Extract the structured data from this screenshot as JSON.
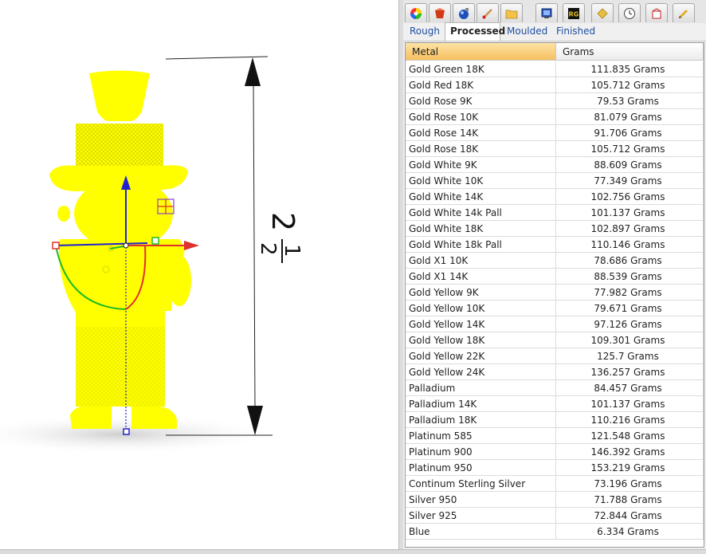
{
  "viewport": {
    "dimension": {
      "whole": "2",
      "numerator": "1",
      "denominator": "2"
    },
    "colors": {
      "model": "#ffff00",
      "x_axis": "#e03030",
      "y_axis": "#2222cc",
      "z_axis": "#22bb22"
    }
  },
  "panel": {
    "icon_tabs": [
      "color-wheel-icon",
      "rendering-icon",
      "material-sphere-icon",
      "brush-icon",
      "folder-icon",
      "display-icon",
      "rg-plugin-icon",
      "gem-icon",
      "clock-icon",
      "jewelry-box-icon",
      "pencil-icon"
    ],
    "rg_label": "RG",
    "sub_tabs": [
      "Rough",
      "Processed",
      "Moulded",
      "Finished"
    ],
    "active_sub_tab": "Processed",
    "table": {
      "headers": {
        "metal": "Metal",
        "grams": "Grams"
      },
      "rows": [
        {
          "metal": "Gold Green 18K",
          "grams": "111.835 Grams"
        },
        {
          "metal": "Gold Red 18K",
          "grams": "105.712 Grams"
        },
        {
          "metal": "Gold Rose 9K",
          "grams": "79.53 Grams"
        },
        {
          "metal": "Gold Rose 10K",
          "grams": "81.079 Grams"
        },
        {
          "metal": "Gold Rose 14K",
          "grams": "91.706 Grams"
        },
        {
          "metal": "Gold Rose 18K",
          "grams": "105.712 Grams"
        },
        {
          "metal": "Gold White 9K",
          "grams": "88.609 Grams"
        },
        {
          "metal": "Gold White 10K",
          "grams": "77.349 Grams"
        },
        {
          "metal": "Gold White 14K",
          "grams": "102.756 Grams"
        },
        {
          "metal": "Gold White 14k Pall",
          "grams": "101.137 Grams"
        },
        {
          "metal": "Gold White 18K",
          "grams": "102.897 Grams"
        },
        {
          "metal": "Gold White 18k Pall",
          "grams": "110.146 Grams"
        },
        {
          "metal": "Gold X1 10K",
          "grams": "78.686 Grams"
        },
        {
          "metal": "Gold X1 14K",
          "grams": "88.539 Grams"
        },
        {
          "metal": "Gold Yellow 9K",
          "grams": "77.982 Grams"
        },
        {
          "metal": "Gold Yellow 10K",
          "grams": "79.671 Grams"
        },
        {
          "metal": "Gold Yellow 14K",
          "grams": "97.126 Grams"
        },
        {
          "metal": "Gold Yellow 18K",
          "grams": "109.301 Grams"
        },
        {
          "metal": "Gold Yellow 22K",
          "grams": "125.7 Grams"
        },
        {
          "metal": "Gold Yellow 24K",
          "grams": "136.257 Grams"
        },
        {
          "metal": "Palladium",
          "grams": "84.457 Grams"
        },
        {
          "metal": "Palladium 14K",
          "grams": "101.137 Grams"
        },
        {
          "metal": "Palladium 18K",
          "grams": "110.216 Grams"
        },
        {
          "metal": "Platinum 585",
          "grams": "121.548 Grams"
        },
        {
          "metal": "Platinum 900",
          "grams": "146.392 Grams"
        },
        {
          "metal": "Platinum 950",
          "grams": "153.219 Grams"
        },
        {
          "metal": "Continum Sterling Silver",
          "grams": "73.196 Grams"
        },
        {
          "metal": "Silver 950",
          "grams": "71.788 Grams"
        },
        {
          "metal": "Silver 925",
          "grams": "72.844 Grams"
        },
        {
          "metal": "Blue",
          "grams": "6.334 Grams"
        }
      ]
    }
  }
}
